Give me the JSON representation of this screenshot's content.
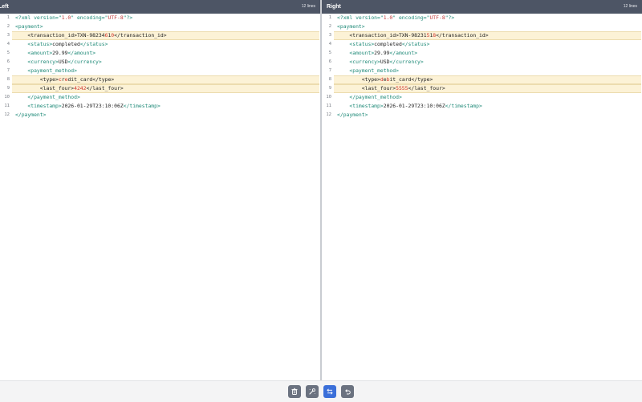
{
  "left_pane": {
    "title": "Left",
    "line_count": "12 lines",
    "lines": [
      {
        "n": "1",
        "segs": [
          [
            "decl",
            "<?xml version=\""
          ],
          [
            "str",
            "1.0"
          ],
          [
            "decl",
            "\" encoding=\""
          ],
          [
            "str",
            "UTF-8"
          ],
          [
            "decl",
            "\"?>"
          ]
        ],
        "hl": false
      },
      {
        "n": "2",
        "segs": [
          [
            "tag",
            "<payment>"
          ]
        ],
        "hl": false
      },
      {
        "n": "3",
        "segs": [
          [
            "txt",
            "    <transaction_id>TXN-98234"
          ],
          [
            "diff",
            "6"
          ],
          [
            "txt",
            "1"
          ],
          [
            "diff",
            "0"
          ],
          [
            "txt",
            "</transaction_id>"
          ]
        ],
        "hl": true
      },
      {
        "n": "4",
        "segs": [
          [
            "tag",
            "    <status>"
          ],
          [
            "txt",
            "completed"
          ],
          [
            "tag",
            "</status>"
          ]
        ],
        "hl": false
      },
      {
        "n": "5",
        "segs": [
          [
            "tag",
            "    <amount>"
          ],
          [
            "txt",
            "29.99"
          ],
          [
            "tag",
            "</amount>"
          ]
        ],
        "hl": false
      },
      {
        "n": "6",
        "segs": [
          [
            "tag",
            "    <currency>"
          ],
          [
            "txt",
            "USD"
          ],
          [
            "tag",
            "</currency>"
          ]
        ],
        "hl": false
      },
      {
        "n": "7",
        "segs": [
          [
            "tag",
            "    <payment_method>"
          ]
        ],
        "hl": false
      },
      {
        "n": "8",
        "segs": [
          [
            "txt",
            "        <type>"
          ],
          [
            "diff",
            "c"
          ],
          [
            "txt",
            "r"
          ],
          [
            "diff",
            "e"
          ],
          [
            "txt",
            "dit_card</type>"
          ]
        ],
        "hl": true
      },
      {
        "n": "9",
        "segs": [
          [
            "txt",
            "        <last_four>"
          ],
          [
            "diff",
            "4242"
          ],
          [
            "txt",
            "</last_four>"
          ]
        ],
        "hl": true
      },
      {
        "n": "10",
        "segs": [
          [
            "tag",
            "    </payment_method>"
          ]
        ],
        "hl": false
      },
      {
        "n": "11",
        "segs": [
          [
            "tag",
            "    <timestamp>"
          ],
          [
            "txt",
            "2026-01-29T23:10:06Z"
          ],
          [
            "tag",
            "</timestamp>"
          ]
        ],
        "hl": false
      },
      {
        "n": "12",
        "segs": [
          [
            "tag",
            "</payment>"
          ]
        ],
        "hl": false
      }
    ]
  },
  "right_pane": {
    "title": "Right",
    "line_count": "12 lines",
    "lines": [
      {
        "n": "1",
        "segs": [
          [
            "decl",
            "<?xml version=\""
          ],
          [
            "str",
            "1.0"
          ],
          [
            "decl",
            "\" encoding=\""
          ],
          [
            "str",
            "UTF-8"
          ],
          [
            "decl",
            "\"?>"
          ]
        ],
        "hl": false
      },
      {
        "n": "2",
        "segs": [
          [
            "tag",
            "<payment>"
          ]
        ],
        "hl": false
      },
      {
        "n": "3",
        "segs": [
          [
            "txt",
            "    <transaction_id>TXN-98231"
          ],
          [
            "diff",
            "5"
          ],
          [
            "txt",
            "1"
          ],
          [
            "diff",
            "8"
          ],
          [
            "txt",
            "</transaction_id>"
          ]
        ],
        "hl": true
      },
      {
        "n": "4",
        "segs": [
          [
            "tag",
            "    <status>"
          ],
          [
            "txt",
            "completed"
          ],
          [
            "tag",
            "</status>"
          ]
        ],
        "hl": false
      },
      {
        "n": "5",
        "segs": [
          [
            "tag",
            "    <amount>"
          ],
          [
            "txt",
            "29.99"
          ],
          [
            "tag",
            "</amount>"
          ]
        ],
        "hl": false
      },
      {
        "n": "6",
        "segs": [
          [
            "tag",
            "    <currency>"
          ],
          [
            "txt",
            "USD"
          ],
          [
            "tag",
            "</currency>"
          ]
        ],
        "hl": false
      },
      {
        "n": "7",
        "segs": [
          [
            "tag",
            "    <payment_method>"
          ]
        ],
        "hl": false
      },
      {
        "n": "8",
        "segs": [
          [
            "txt",
            "        <type>"
          ],
          [
            "diff",
            "d"
          ],
          [
            "txt",
            "e"
          ],
          [
            "diff",
            "b"
          ],
          [
            "txt",
            "it_card</type>"
          ]
        ],
        "hl": true
      },
      {
        "n": "9",
        "segs": [
          [
            "txt",
            "        <last_four>"
          ],
          [
            "diff",
            "5555"
          ],
          [
            "txt",
            "</last_four>"
          ]
        ],
        "hl": true
      },
      {
        "n": "10",
        "segs": [
          [
            "tag",
            "    </payment_method>"
          ]
        ],
        "hl": false
      },
      {
        "n": "11",
        "segs": [
          [
            "tag",
            "    <timestamp>"
          ],
          [
            "txt",
            "2026-01-29T23:10:06Z"
          ],
          [
            "tag",
            "</timestamp>"
          ]
        ],
        "hl": false
      },
      {
        "n": "12",
        "segs": [
          [
            "tag",
            "</payment>"
          ]
        ],
        "hl": false
      }
    ]
  },
  "toolbar": {
    "buttons": [
      {
        "name": "delete",
        "icon": "trash-icon"
      },
      {
        "name": "tool",
        "icon": "wrench-icon"
      },
      {
        "name": "swap",
        "icon": "swap-icon"
      },
      {
        "name": "undo",
        "icon": "undo-icon"
      }
    ]
  },
  "colors": {
    "header_bg": "#4d5565",
    "highlight_bg": "#fcf2d6",
    "tag": "#1f8a78",
    "string": "#c23b3b",
    "diff_char": "#d0342c",
    "swap_button": "#3b6fd9"
  }
}
